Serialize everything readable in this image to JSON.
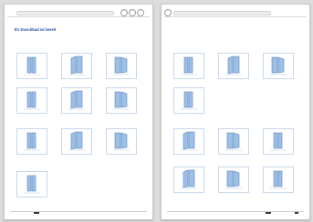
{
  "pages": [
    {
      "title": "Ihr Duschbad ist bereit",
      "subtitle": "",
      "sections": [
        "",
        "",
        ""
      ],
      "tiles": [
        {
          "caption": ""
        },
        {
          "caption": ""
        },
        {
          "caption": ""
        },
        {
          "caption": ""
        },
        {
          "caption": ""
        },
        {
          "caption": ""
        },
        {
          "caption": ""
        },
        {
          "caption": ""
        },
        {
          "caption": ""
        },
        {
          "caption": ""
        }
      ]
    },
    {
      "title": "",
      "subtitle": "",
      "sections": [
        "",
        ""
      ],
      "tiles": [
        {
          "caption": ""
        },
        {
          "caption": ""
        },
        {
          "caption": ""
        },
        {
          "caption": ""
        },
        {
          "caption": ""
        },
        {
          "caption": ""
        },
        {
          "caption": ""
        },
        {
          "caption": ""
        },
        {
          "caption": ""
        },
        {
          "caption": ""
        }
      ]
    }
  ],
  "colors": {
    "accent": "#1c4fa0",
    "glass": "#9cc0e6",
    "frame": "#5f86bd",
    "tile_border": "#c7d7ea"
  },
  "icons": [
    "back-icon",
    "forward-icon",
    "close-icon",
    "shower-enclosure-icon"
  ]
}
